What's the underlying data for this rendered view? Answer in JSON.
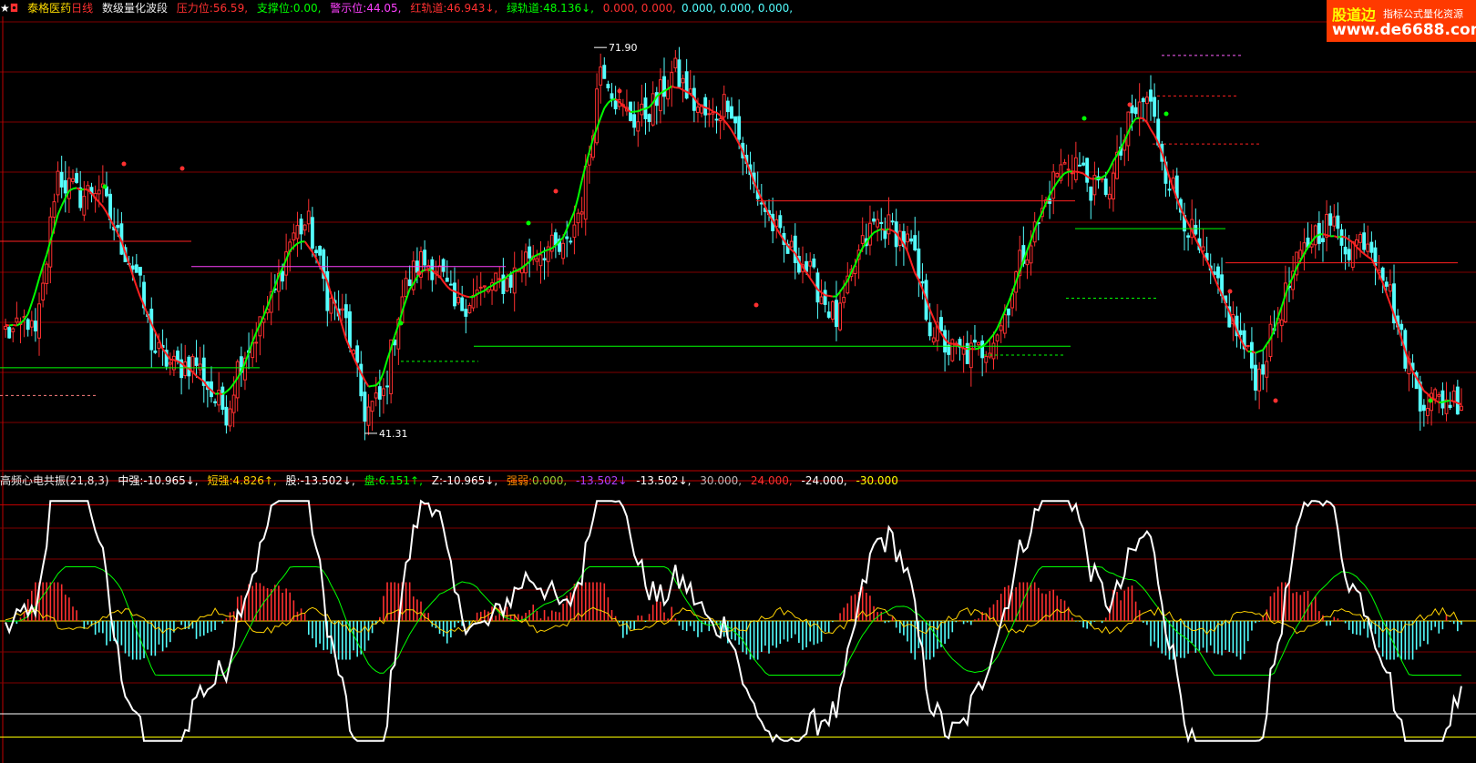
{
  "header": {
    "icons": [
      "star-icon",
      "ring-icon"
    ],
    "stock_name": "泰格医药",
    "period": "日线",
    "indicator_name": "数级量化波段",
    "pressure_label": "压力位:",
    "pressure_value": "56.59,",
    "support_label": "支撑位:",
    "support_value": "0.00,",
    "warning_label": "警示位:",
    "warning_value": "44.05,",
    "red_channel_label": "红轨道:",
    "red_channel_value": "46.943↓,",
    "green_channel_label": "绿轨道:",
    "green_channel_value": "48.136↓,",
    "values_red": "0.000, 0.000,",
    "values_cyan": "0.000, 0.000, 0.000,"
  },
  "watermark": {
    "brand": "股道边",
    "slogan": "指标公式量化资源",
    "url": "www.de6688.com"
  },
  "sub_header": {
    "indicator_name": "高频心电共振",
    "params": "(21,8,3)",
    "zq_label": "中强:",
    "zq_value": "-10.965↓,",
    "dq_label": "短强:",
    "dq_value": "4.826↑,",
    "gu_label": "股:",
    "gu_value": "-13.502↓,",
    "pan_label": "盘:",
    "pan_value": "6.151↑,",
    "z_label": "Z:",
    "z_value": "-10.965↓,",
    "qr_label": "强弱:",
    "qr_value": "0.000,",
    "v1": "-13.502↓",
    "v2": "-13.502↓,",
    "v3": "30.000,",
    "v4": "24.000,",
    "v5": "-24.000,",
    "v6": "-30.000"
  },
  "colors": {
    "background": "#000000",
    "up_candle": "#ff3030",
    "down_candle": "#54ffff",
    "green_line": "#00ff00",
    "red_line": "#ff2020",
    "magenta_line": "#ff40ff",
    "white_line": "#ffffff",
    "grid": "#800000"
  },
  "chart_data": [
    {
      "type": "candlestick",
      "title": "",
      "high_label": "71.90",
      "low_label": "41.31",
      "ylim": [
        39,
        74
      ],
      "n_bars": 390,
      "close_keypoints": [
        [
          0,
          49.5
        ],
        [
          18,
          49.2
        ],
        [
          30,
          50.5
        ],
        [
          38,
          48.5
        ],
        [
          48,
          53
        ],
        [
          62,
          62
        ],
        [
          72,
          61
        ],
        [
          90,
          60
        ],
        [
          108,
          61
        ],
        [
          128,
          57
        ],
        [
          150,
          54
        ],
        [
          168,
          48
        ],
        [
          192,
          46.5
        ],
        [
          215,
          47
        ],
        [
          235,
          44
        ],
        [
          250,
          43
        ],
        [
          262,
          47
        ],
        [
          280,
          49
        ],
        [
          300,
          52
        ],
        [
          320,
          57
        ],
        [
          338,
          58
        ],
        [
          360,
          52
        ],
        [
          380,
          50
        ],
        [
          400,
          43
        ],
        [
          420,
          44
        ],
        [
          440,
          52
        ],
        [
          460,
          55
        ],
        [
          480,
          54.5
        ],
        [
          500,
          51
        ],
        [
          515,
          52
        ],
        [
          530,
          52.5
        ],
        [
          560,
          53.5
        ],
        [
          580,
          55.5
        ],
        [
          600,
          56
        ],
        [
          620,
          55.5
        ],
        [
          640,
          60
        ],
        [
          660,
          71
        ],
        [
          680,
          67
        ],
        [
          700,
          66
        ],
        [
          720,
          67.5
        ],
        [
          740,
          70
        ],
        [
          760,
          67.5
        ],
        [
          780,
          66
        ],
        [
          800,
          68
        ],
        [
          820,
          62
        ],
        [
          840,
          59
        ],
        [
          860,
          56
        ],
        [
          880,
          55
        ],
        [
          900,
          52.5
        ],
        [
          920,
          50
        ],
        [
          940,
          55
        ],
        [
          960,
          58
        ],
        [
          980,
          57.5
        ],
        [
          1000,
          56
        ],
        [
          1020,
          50
        ],
        [
          1040,
          48
        ],
        [
          1060,
          47.5
        ],
        [
          1080,
          48
        ],
        [
          1100,
          50
        ],
        [
          1120,
          55
        ],
        [
          1140,
          58
        ],
        [
          1160,
          62
        ],
        [
          1180,
          63
        ],
        [
          1200,
          60.5
        ],
        [
          1220,
          61
        ],
        [
          1240,
          66
        ],
        [
          1260,
          68
        ],
        [
          1280,
          62
        ],
        [
          1300,
          58.5
        ],
        [
          1320,
          55
        ],
        [
          1340,
          52
        ],
        [
          1360,
          49
        ],
        [
          1380,
          45.5
        ],
        [
          1400,
          50
        ],
        [
          1420,
          54
        ],
        [
          1440,
          57
        ],
        [
          1460,
          58
        ],
        [
          1480,
          56
        ],
        [
          1500,
          57
        ],
        [
          1520,
          54
        ],
        [
          1540,
          48
        ],
        [
          1560,
          44
        ]
      ]
    },
    {
      "type": "line",
      "title": "",
      "ylim": [
        -32,
        32
      ],
      "series": [
        {
          "name": "",
          "color": "#ffffff"
        },
        {
          "name": "",
          "color": "#00ff00"
        },
        {
          "name": "",
          "color": "#ffd200"
        }
      ],
      "reference_levels": [
        30,
        24,
        -24,
        -30
      ]
    }
  ]
}
